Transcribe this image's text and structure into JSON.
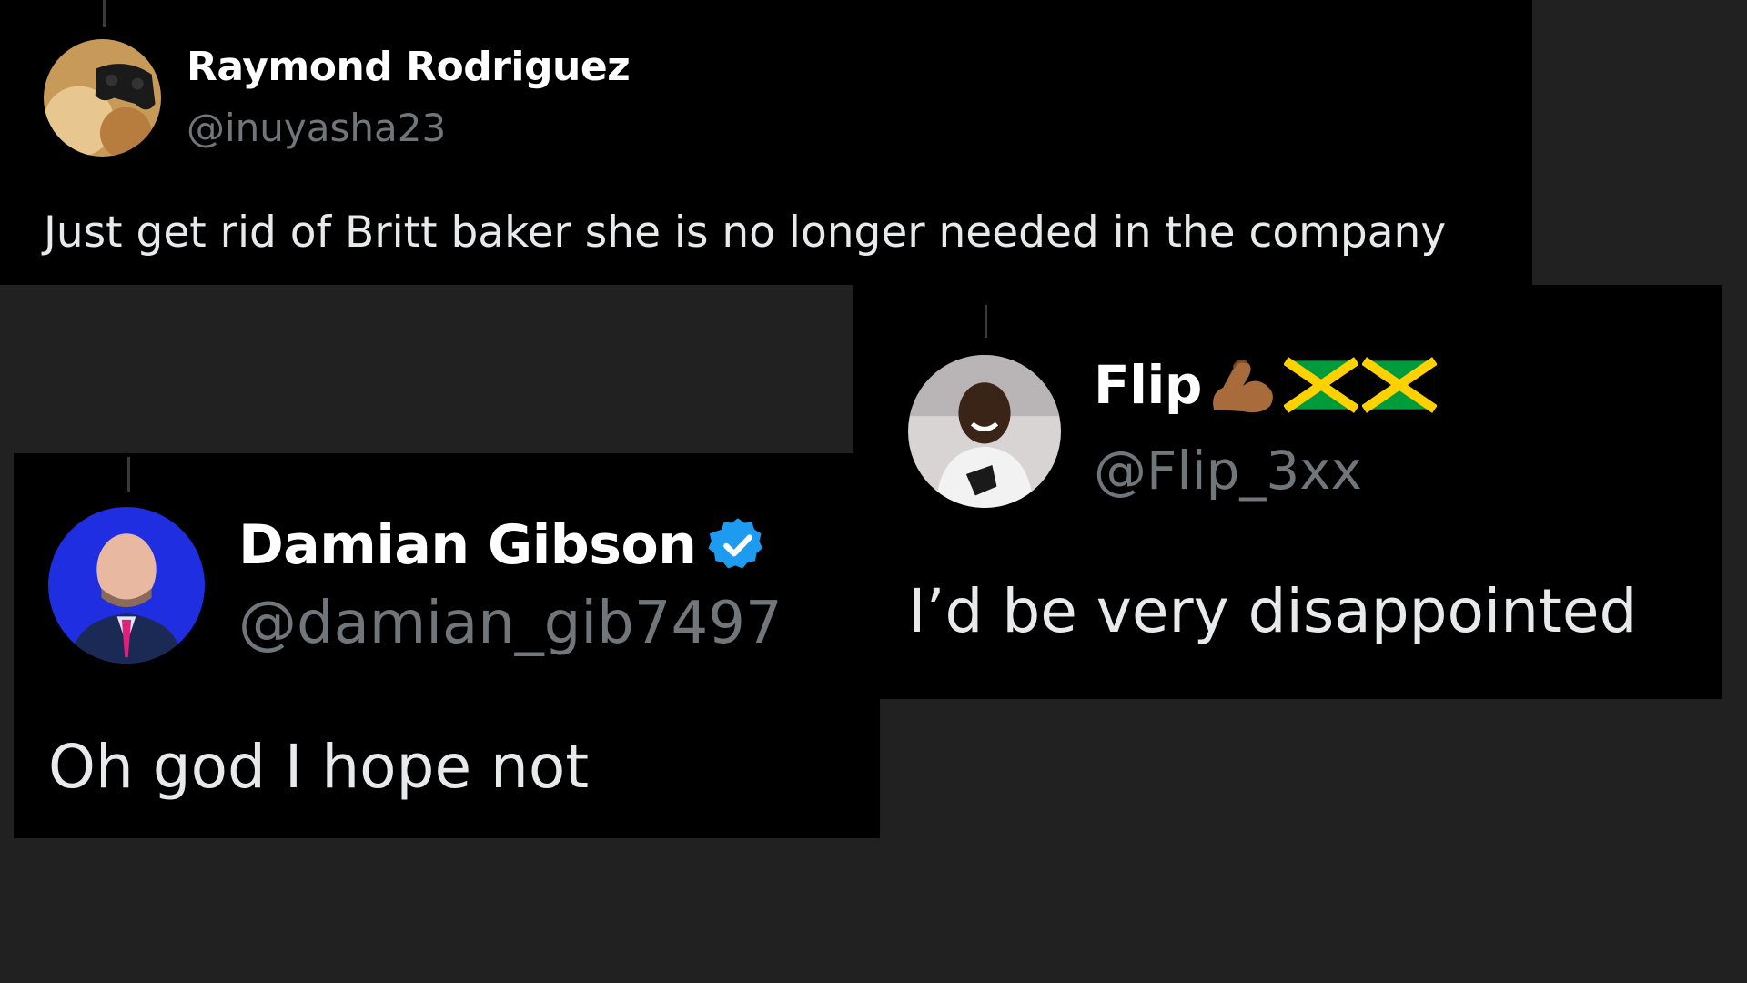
{
  "posts": [
    {
      "name": "Raymond Rodriguez",
      "handle": "@inuyasha23",
      "text": "Just get rid of Britt baker she is no longer needed in the company",
      "avatar": "gamepad-avatar"
    },
    {
      "name": "Damian Gibson",
      "handle": "@damian_gib7497",
      "text": "Oh god I hope not",
      "verified": true,
      "avatar": "person-avatar"
    },
    {
      "name": "Flip",
      "name_emojis": [
        "flexed-biceps-emoji",
        "jamaica-flag-emoji",
        "jamaica-flag-emoji"
      ],
      "handle": "@Flip_3xx",
      "text": "I’d be very disappointed",
      "avatar": "person-avatar"
    }
  ],
  "colors": {
    "background": "#212121",
    "card": "#000000",
    "name": "#ffffff",
    "handle": "#71767b",
    "text": "#e7e9ea",
    "verified": "#1d9bf0",
    "jamaica_green": "#009b3a",
    "jamaica_gold": "#fed100"
  }
}
